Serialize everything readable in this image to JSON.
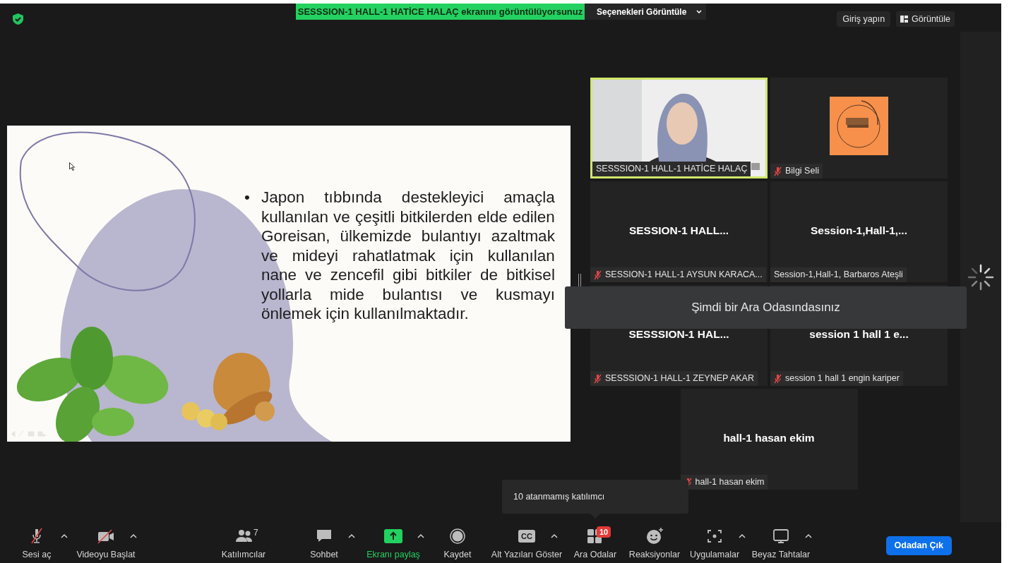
{
  "top_bar": {
    "share_banner": "SESSSION-1 HALL-1 HATİCE HALAÇ ekranını görüntülüyorsunuz",
    "view_options": "Seçenekleri Görüntüle",
    "sign_in": "Giriş yapın",
    "view": "Görüntüle"
  },
  "shared_slide": {
    "bullet_marker": "•",
    "text": "Japon tıbbında destekleyici amaçla kullanılan ve çeşitli bitkilerden elde edilen Goreisan, ülkemizde bulantıyı azaltmak ve mideyi rahatlatmak için kullanılan nane ve zencefil gibi bitkiler de bitkisel yollarla mide bulantısı ve kusmayı önlemek için kullanılmaktadır."
  },
  "gallery": [
    {
      "kind": "video",
      "label": "SESSSION-1 HALL-1 HATİCE HALAÇ",
      "muted": false,
      "active_speaker": true
    },
    {
      "kind": "avatar",
      "label": "Bilgi Seli",
      "muted": true,
      "active_speaker": false
    },
    {
      "kind": "name",
      "display_name": "SESSION-1  HALL...",
      "label": "SESSION-1 HALL-1 AYSUN KARACA...",
      "muted": true,
      "active_speaker": false
    },
    {
      "kind": "name",
      "display_name": "Session-1,Hall-1,...",
      "label": "Session-1,Hall-1, Barbaros Ateşli",
      "muted": false,
      "active_speaker": false
    },
    {
      "kind": "name",
      "display_name": "SESSSION-1  HAL...",
      "label": "SESSSION-1 HALL-1 ZEYNEP AKAR",
      "muted": true,
      "active_speaker": false
    },
    {
      "kind": "name",
      "display_name": "session 1 hall 1 e...",
      "label": "session 1 hall 1 engin kariper",
      "muted": true,
      "active_speaker": false
    },
    {
      "kind": "name",
      "display_name": "hall-1 hasan ekim",
      "label": "hall-1 hasan ekim",
      "muted": true,
      "active_speaker": false
    }
  ],
  "notification": "Şimdi bir Ara Odasındasınız",
  "tooltip": "10 atanmamış katılımcı",
  "toolbar": [
    {
      "kind": "mic",
      "label": "Sesi aç",
      "menu": true
    },
    {
      "kind": "video",
      "label": "Videoyu Başlat",
      "menu": true
    },
    {
      "kind": "participants",
      "label": "Katılımcılar",
      "count": "7",
      "menu": false
    },
    {
      "kind": "chat",
      "label": "Sohbet",
      "menu": true
    },
    {
      "kind": "share",
      "label": "Ekranı paylaş",
      "menu": true
    },
    {
      "kind": "record",
      "label": "Kaydet",
      "menu": false
    },
    {
      "kind": "captions",
      "label": "Alt Yazıları Göster",
      "icon_text": "CC",
      "menu": true
    },
    {
      "kind": "breakout",
      "label": "Ara Odalar",
      "badge": "10",
      "menu": false
    },
    {
      "kind": "reactions",
      "label": "Reaksiyonlar",
      "menu": false
    },
    {
      "kind": "apps",
      "label": "Uygulamalar",
      "menu": true
    },
    {
      "kind": "whiteboard",
      "label": "Beyaz Tahtalar",
      "menu": true
    }
  ],
  "leave_button": "Odadan Çık"
}
